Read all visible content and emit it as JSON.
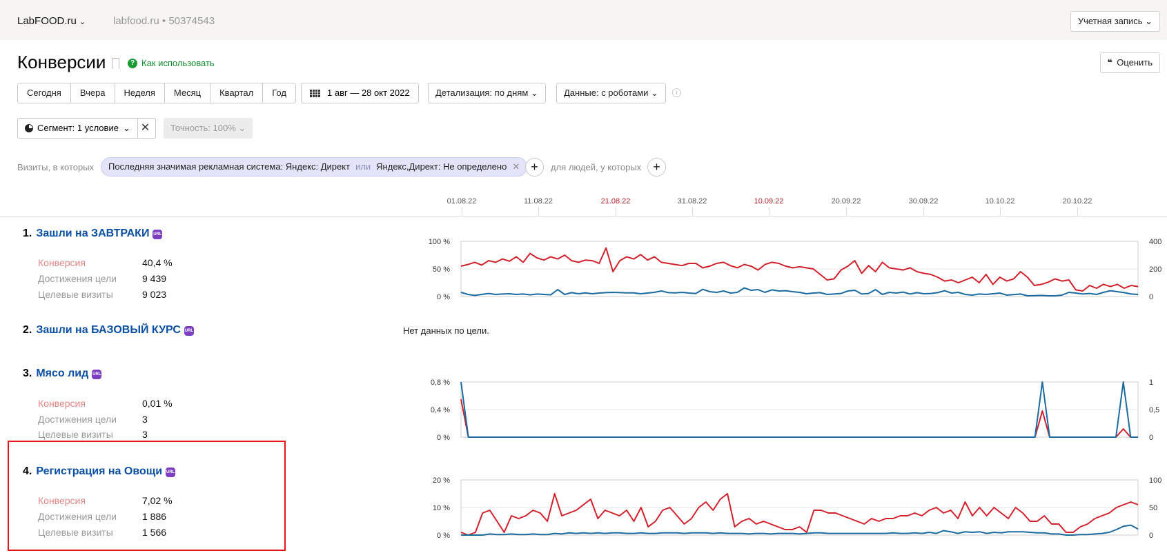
{
  "header": {
    "site_name": "LabFOOD.ru",
    "site_url": "labfood.ru",
    "counter_id": "50374543",
    "account_label": "Учетная запись"
  },
  "title_bar": {
    "title": "Конверсии",
    "help_link": "Как использовать",
    "rate_button": "Оценить"
  },
  "toolbar": {
    "periods": [
      "Сегодня",
      "Вчера",
      "Неделя",
      "Месяц",
      "Квартал",
      "Год"
    ],
    "date_range": "1 авг — 28 окт 2022",
    "detail_dropdown": "Детализация: по дням",
    "data_dropdown": "Данные: с роботами"
  },
  "segment": {
    "segment_button": "Сегмент: 1 условие",
    "accuracy_button": "Точность: 100%"
  },
  "filter": {
    "prefix": "Визиты, в которых",
    "chip_part1": "Последняя значимая рекламная система: Яндекс: Директ",
    "chip_or": "или",
    "chip_part2": "Яндекс,Директ: Не определено",
    "people_label": "для людей, у которых"
  },
  "timeline": {
    "ticks": [
      {
        "label": "01.08.22",
        "holiday": false
      },
      {
        "label": "11.08.22",
        "holiday": false
      },
      {
        "label": "21.08.22",
        "holiday": true
      },
      {
        "label": "31.08.22",
        "holiday": false
      },
      {
        "label": "10.09.22",
        "holiday": true
      },
      {
        "label": "20.09.22",
        "holiday": false
      },
      {
        "label": "30.09.22",
        "holiday": false
      },
      {
        "label": "10.10.22",
        "holiday": false
      },
      {
        "label": "20.10.22",
        "holiday": false
      }
    ]
  },
  "goals": [
    {
      "number": "1.",
      "name": "Зашли на ЗАВТРАКИ",
      "badge": "URL",
      "metrics": [
        {
          "label": "Конверсия",
          "value": "40,4 %"
        },
        {
          "label": "Достижения цели",
          "value": "9 439"
        },
        {
          "label": "Целевые визиты",
          "value": "9 023"
        }
      ]
    },
    {
      "number": "2.",
      "name": "Зашли на БАЗОВЫЙ КУРС",
      "badge": "URL",
      "no_data": "Нет данных по цели."
    },
    {
      "number": "3.",
      "name": "Мясо лид",
      "badge": "URL",
      "metrics": [
        {
          "label": "Конверсия",
          "value": "0,01 %"
        },
        {
          "label": "Достижения цели",
          "value": "3"
        },
        {
          "label": "Целевые визиты",
          "value": "3"
        }
      ]
    },
    {
      "number": "4.",
      "name": "Регистрация на Овощи",
      "badge": "URL",
      "metrics": [
        {
          "label": "Конверсия",
          "value": "7,02 %"
        },
        {
          "label": "Достижения цели",
          "value": "1 886"
        },
        {
          "label": "Целевые визиты",
          "value": "1 566"
        }
      ]
    }
  ],
  "colors": {
    "conversion_line": "#d0202b",
    "visits_line": "#1a6aa0",
    "goal_link": "#0b4fa3",
    "highlight": "#e2171c"
  },
  "chart_data": [
    {
      "type": "line",
      "goal": "Зашли на ЗАВТРАКИ",
      "left_axis_ticks": [
        "100 %",
        "50 %",
        "0 %"
      ],
      "right_axis_ticks": [
        "400",
        "200",
        "0"
      ],
      "ylim_left": [
        0,
        100
      ],
      "ylim_right": [
        0,
        400
      ],
      "series": [
        {
          "values": [
            55,
            58,
            62,
            57,
            65,
            62,
            68,
            64,
            72,
            62,
            78,
            70,
            66,
            72,
            68,
            75,
            65,
            62,
            66,
            65,
            60,
            88,
            45,
            65,
            72,
            68,
            76,
            66,
            72,
            62,
            60,
            58,
            56,
            60,
            60,
            52,
            55,
            60,
            62,
            56,
            52,
            58,
            55,
            48,
            58,
            62,
            60,
            55,
            52,
            54,
            52,
            50,
            40,
            30,
            32,
            48,
            55,
            65,
            42,
            56,
            45,
            62,
            52,
            50,
            48,
            52,
            45,
            42,
            40,
            35,
            28,
            30,
            25,
            30,
            35,
            25,
            40,
            22,
            35,
            28,
            32,
            45,
            35,
            20,
            22,
            26,
            32,
            28,
            30,
            12,
            10,
            20,
            15,
            22,
            18,
            22,
            15,
            20,
            18
          ]
        },
        {
          "values": [
            30,
            15,
            8,
            15,
            22,
            15,
            18,
            20,
            15,
            18,
            12,
            18,
            15,
            12,
            50,
            15,
            28,
            20,
            26,
            20,
            25,
            28,
            30,
            28,
            26,
            26,
            20,
            25,
            30,
            40,
            28,
            26,
            30,
            25,
            22,
            52,
            35,
            30,
            40,
            25,
            30,
            62,
            45,
            50,
            30,
            48,
            40,
            42,
            35,
            30,
            20,
            25,
            28,
            15,
            18,
            22,
            40,
            45,
            18,
            22,
            50,
            15,
            30,
            25,
            32,
            18,
            28,
            20,
            22,
            28,
            42,
            25,
            30,
            15,
            10,
            18,
            15,
            20,
            25,
            10,
            14,
            18,
            5,
            6,
            8,
            5,
            5,
            10,
            30,
            25,
            18,
            22,
            15,
            30,
            42,
            35,
            28,
            18,
            15
          ]
        }
      ]
    },
    {
      "type": "line",
      "goal": "Мясо лид",
      "left_axis_ticks": [
        "0,8 %",
        "0,4 %",
        "0 %"
      ],
      "right_axis_ticks": [
        "1",
        "0,5",
        "0"
      ],
      "ylim_left": [
        0,
        0.8
      ],
      "ylim_right": [
        0,
        1
      ],
      "series": [
        {
          "values": [
            0.55,
            0,
            0,
            0,
            0,
            0,
            0,
            0,
            0,
            0,
            0,
            0,
            0,
            0,
            0,
            0,
            0,
            0,
            0,
            0,
            0,
            0,
            0,
            0,
            0,
            0,
            0,
            0,
            0,
            0,
            0,
            0,
            0,
            0,
            0,
            0,
            0,
            0,
            0,
            0,
            0,
            0,
            0,
            0,
            0,
            0,
            0,
            0,
            0,
            0,
            0,
            0,
            0,
            0,
            0,
            0,
            0,
            0,
            0,
            0,
            0,
            0,
            0,
            0,
            0,
            0,
            0,
            0,
            0,
            0,
            0,
            0,
            0,
            0,
            0,
            0,
            0,
            0,
            0,
            0.38,
            0,
            0,
            0,
            0,
            0,
            0,
            0,
            0,
            0,
            0,
            0.12,
            0,
            0
          ]
        },
        {
          "values": [
            1,
            0,
            0,
            0,
            0,
            0,
            0,
            0,
            0,
            0,
            0,
            0,
            0,
            0,
            0,
            0,
            0,
            0,
            0,
            0,
            0,
            0,
            0,
            0,
            0,
            0,
            0,
            0,
            0,
            0,
            0,
            0,
            0,
            0,
            0,
            0,
            0,
            0,
            0,
            0,
            0,
            0,
            0,
            0,
            0,
            0,
            0,
            0,
            0,
            0,
            0,
            0,
            0,
            0,
            0,
            0,
            0,
            0,
            0,
            0,
            0,
            0,
            0,
            0,
            0,
            0,
            0,
            0,
            0,
            0,
            0,
            0,
            0,
            0,
            0,
            0,
            0,
            0,
            0,
            1,
            0,
            0,
            0,
            0,
            0,
            0,
            0,
            0,
            0,
            0,
            1,
            0,
            0
          ]
        }
      ]
    },
    {
      "type": "line",
      "goal": "Регистрация на Овощи",
      "left_axis_ticks": [
        "20 %",
        "10 %",
        "0 %"
      ],
      "right_axis_ticks": [
        "100",
        "50",
        "0"
      ],
      "ylim_left": [
        0,
        20
      ],
      "ylim_right": [
        0,
        100
      ],
      "series": [
        {
          "values": [
            1,
            0,
            1,
            8,
            9,
            5,
            1,
            7,
            6,
            7,
            9,
            8,
            5,
            15,
            7,
            8,
            9,
            11,
            13,
            6,
            9,
            8,
            7,
            9,
            5,
            10,
            3,
            5,
            9,
            10,
            7,
            4,
            6,
            10,
            12,
            9,
            13,
            15,
            3,
            5,
            6,
            4,
            5,
            4,
            3,
            2,
            2,
            3,
            1,
            9,
            9,
            8,
            8,
            7,
            6,
            5,
            4,
            6,
            5,
            6,
            6,
            7,
            7,
            8,
            7,
            9,
            10,
            8,
            9,
            6,
            12,
            7,
            10,
            7,
            10,
            8,
            6,
            10,
            8,
            5,
            5,
            7,
            4,
            4,
            1,
            1,
            3,
            4,
            6,
            7,
            8,
            10,
            11,
            12,
            11
          ]
        },
        {
          "values": [
            0,
            0,
            0,
            0,
            2,
            1,
            1,
            2,
            1,
            1,
            2,
            1,
            1,
            3,
            2,
            4,
            3,
            4,
            3,
            4,
            3,
            4,
            4,
            3,
            3,
            4,
            3,
            3,
            4,
            4,
            4,
            3,
            4,
            4,
            4,
            3,
            4,
            3,
            3,
            3,
            2,
            3,
            3,
            2,
            3,
            3,
            3,
            2,
            3,
            4,
            4,
            3,
            3,
            3,
            3,
            3,
            3,
            3,
            3,
            3,
            4,
            3,
            3,
            4,
            3,
            5,
            3,
            8,
            6,
            3,
            6,
            5,
            6,
            3,
            5,
            4,
            6,
            6,
            6,
            5,
            4,
            4,
            2,
            2,
            0,
            0,
            1,
            1,
            2,
            3,
            5,
            10,
            16,
            18,
            11
          ]
        }
      ]
    }
  ]
}
